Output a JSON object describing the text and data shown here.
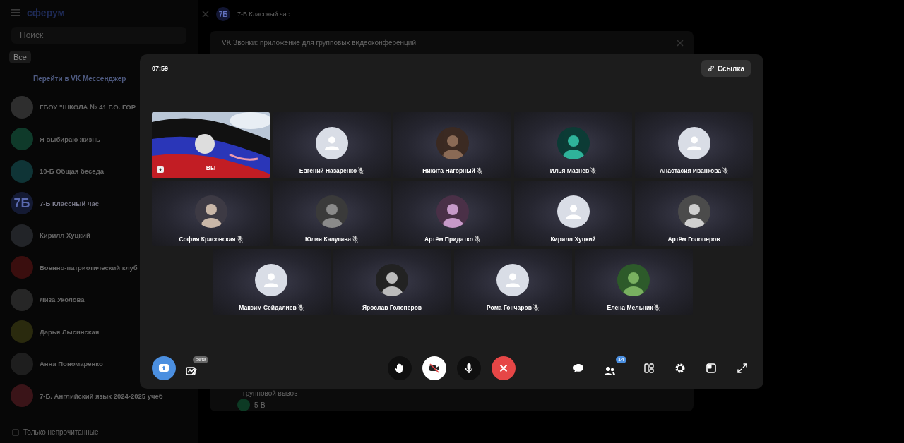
{
  "app": {
    "logo": "сферум",
    "search": {
      "placeholder": "Поиск"
    },
    "filters": [
      {
        "label": "Все",
        "selected": true
      }
    ],
    "promo": "Перейти в VK Мессенджер",
    "chats": [
      {
        "title": "ГБОУ \"ШКОЛА № 41 Г.О. ГОР",
        "color": "#2e2e2e",
        "selected": false
      },
      {
        "title": "Я выбираю жизнь",
        "color": "#0f3a2a",
        "selected": false
      },
      {
        "title": "10-Б Общая беседа",
        "color": "#0f3436",
        "selected": false
      },
      {
        "title": "7-Б Классный час",
        "color": "#141a33",
        "avatar_text": "7Б",
        "selected": true
      },
      {
        "title": "Кирилл Хуцкий",
        "color": "#222428",
        "selected": false
      },
      {
        "title": "Военно-патриотический клуб",
        "color": "#3a0e0e",
        "selected": false
      },
      {
        "title": "Лиза Уколова",
        "color": "#262626",
        "selected": false
      },
      {
        "title": "Дарья Лысинская",
        "color": "#2a2a0e",
        "selected": false
      },
      {
        "title": "Анна Пономаренко",
        "color": "#1e1e1e",
        "selected": false
      },
      {
        "title": "7-Б. Английский язык 2024-2025 учеб",
        "color": "#3a1418",
        "selected": false
      }
    ],
    "unread_only": {
      "label": "Только непрочитанные",
      "checked": false
    }
  },
  "chat": {
    "title": "7-Б Классный час",
    "avatar_text": "7Б",
    "banner": "VK Звонки: приложение для групповых видеоконференций",
    "rows": [
      "групповой вызов",
      "5-В"
    ]
  },
  "call": {
    "timer": "07:59",
    "link_button": "Ссылка",
    "participants": [
      {
        "name": "Вы",
        "kind": "video",
        "muted": false
      },
      {
        "name": "Евгений Назаренко",
        "kind": "placeholder",
        "muted": true
      },
      {
        "name": "Никита Нагорный",
        "muted": true
      },
      {
        "name": "Илья Мазнев",
        "muted": true
      },
      {
        "name": "Анастасия Иванкова",
        "kind": "placeholder",
        "muted": true
      },
      {
        "name": "София Красовская",
        "muted": true
      },
      {
        "name": "Юлия Калугина",
        "muted": true
      },
      {
        "name": "Артём Придатко",
        "muted": true
      },
      {
        "name": "Кирилл Хуцкий",
        "kind": "placeholder",
        "muted": false
      },
      {
        "name": "Артём Голоперов",
        "muted": false
      },
      {
        "name": "Максим Сейдалиев",
        "kind": "placeholder",
        "muted": true
      },
      {
        "name": "Ярослав Голоперов",
        "muted": false
      },
      {
        "name": "Рома Гончаров",
        "kind": "placeholder",
        "muted": true
      },
      {
        "name": "Елена Мельник",
        "muted": true
      }
    ],
    "left_controls": [
      {
        "kind": "share",
        "on": true
      },
      {
        "kind": "board",
        "badge": "beta"
      }
    ],
    "center_controls": [
      {
        "kind": "hand",
        "on": false
      },
      {
        "kind": "camera",
        "on": false
      },
      {
        "kind": "mic",
        "on": true
      },
      {
        "kind": "end"
      }
    ],
    "right_controls": [
      {
        "kind": "chat"
      },
      {
        "kind": "people",
        "badge": "14"
      },
      {
        "kind": "layout"
      },
      {
        "kind": "settings"
      },
      {
        "kind": "pip"
      },
      {
        "kind": "fullscreen"
      }
    ]
  }
}
